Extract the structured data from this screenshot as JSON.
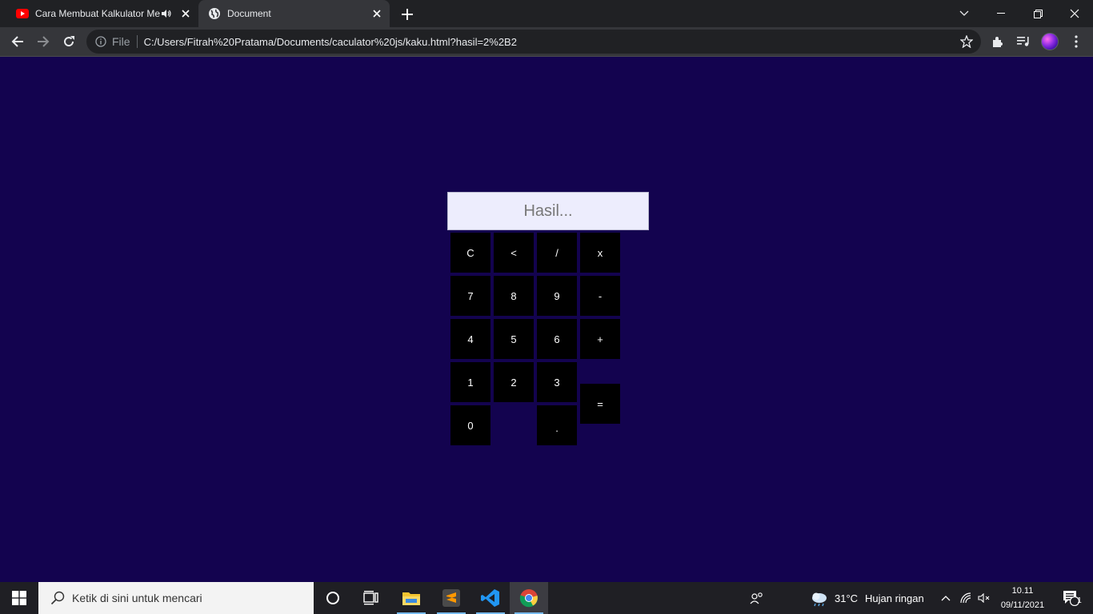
{
  "browser": {
    "tabs": [
      {
        "title": "Cara Membuat Kalkulator Me",
        "favicon": "youtube-icon",
        "audio": true,
        "active": false
      },
      {
        "title": "Document",
        "favicon": "globe-icon",
        "active": true
      }
    ],
    "new_tab_label": "+",
    "address": {
      "chip": "File",
      "url": "C:/Users/Fitrah%20Pratama/Documents/caculator%20js/kaku.html?hasil=2%2B2"
    }
  },
  "page": {
    "background_color": "#13034f",
    "display": {
      "placeholder": "Hasil...",
      "value": ""
    },
    "keys": {
      "clear": "C",
      "backspace": "<",
      "divide": "/",
      "multiply": "x",
      "seven": "7",
      "eight": "8",
      "nine": "9",
      "minus": "-",
      "four": "4",
      "five": "5",
      "six": "6",
      "plus": "+",
      "one": "1",
      "two": "2",
      "three": "3",
      "equals": "=",
      "zero": "0",
      "decimal": "."
    }
  },
  "taskbar": {
    "search_placeholder": "Ketik di sini untuk mencari",
    "weather": {
      "temp": "31°C",
      "condition": "Hujan ringan"
    },
    "clock": {
      "time": "10.11",
      "date": "09/11/2021"
    },
    "notification_count": "1"
  }
}
